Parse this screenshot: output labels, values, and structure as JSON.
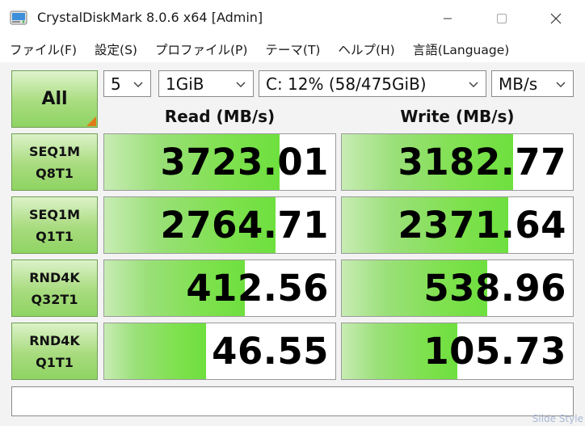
{
  "window": {
    "title": "CrystalDiskMark 8.0.6 x64 [Admin]"
  },
  "menu": [
    {
      "label": "ファイル(F)"
    },
    {
      "label": "設定(S)"
    },
    {
      "label": "プロファイル(P)"
    },
    {
      "label": "テーマ(T)"
    },
    {
      "label": "ヘルプ(H)"
    },
    {
      "label": "言語(Language)"
    }
  ],
  "controls": {
    "all_label": "All",
    "count": "5",
    "size": "1GiB",
    "drive": "C: 12% (58/475GiB)",
    "unit": "MB/s"
  },
  "headers": {
    "read": "Read (MB/s)",
    "write": "Write (MB/s)"
  },
  "tests": [
    {
      "line1": "SEQ1M",
      "line2": "Q8T1",
      "read": "3723.01",
      "write": "3182.77",
      "read_fill": 0.76,
      "write_fill": 0.74
    },
    {
      "line1": "SEQ1M",
      "line2": "Q1T1",
      "read": "2764.71",
      "write": "2371.64",
      "read_fill": 0.74,
      "write_fill": 0.72
    },
    {
      "line1": "RND4K",
      "line2": "Q32T1",
      "read": "412.56",
      "write": "538.96",
      "read_fill": 0.61,
      "write_fill": 0.63
    },
    {
      "line1": "RND4K",
      "line2": "Q1T1",
      "read": "46.55",
      "write": "105.73",
      "read_fill": 0.44,
      "write_fill": 0.5
    }
  ],
  "comment": "",
  "colors": {
    "bar_green": "#7fe14f",
    "button_green": "#a8dc7f",
    "corner_orange": "#e07b1a"
  },
  "watermark": "Slide Style"
}
